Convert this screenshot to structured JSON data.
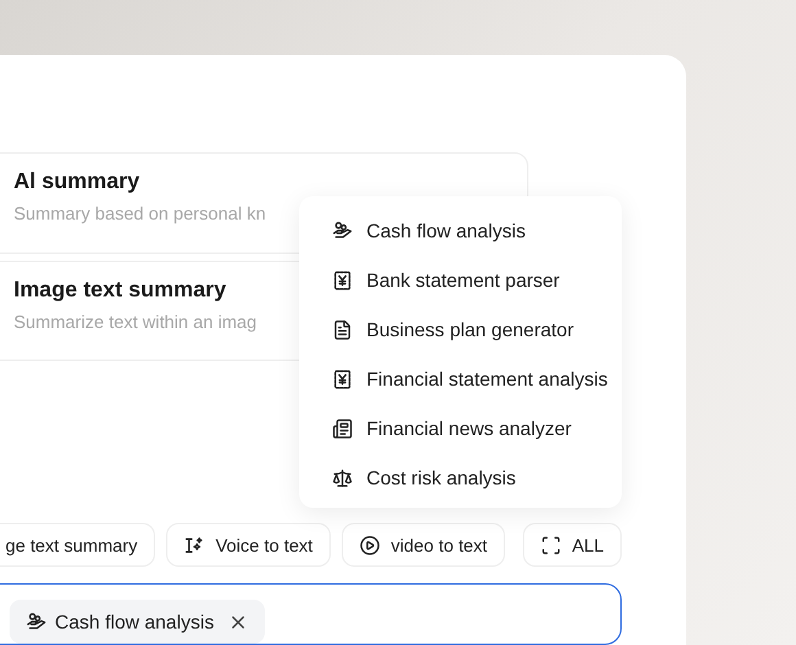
{
  "cards": [
    {
      "title": "Al summary",
      "description": "Summary based on personal kn"
    },
    {
      "title": "Image text summary",
      "description": "Summarize text within an imag"
    }
  ],
  "menu": {
    "items": [
      {
        "label": "Cash flow analysis",
        "kind": "cash"
      },
      {
        "label": "Bank statement parser",
        "kind": "yen"
      },
      {
        "label": "Business plan generator",
        "kind": "document"
      },
      {
        "label": "Financial statement analysis",
        "kind": "yen"
      },
      {
        "label": "Financial news analyzer",
        "kind": "news"
      },
      {
        "label": "Cost risk analysis",
        "kind": "scale"
      }
    ]
  },
  "chips": [
    {
      "label": "ge text summary",
      "kind": "none"
    },
    {
      "label": "Voice to text",
      "kind": "voice"
    },
    {
      "label": "video to text",
      "kind": "video"
    },
    {
      "label": "ALL",
      "kind": "all"
    }
  ],
  "input": {
    "tags": [
      {
        "label": "Cash flow analysis",
        "kind": "cash"
      }
    ]
  }
}
